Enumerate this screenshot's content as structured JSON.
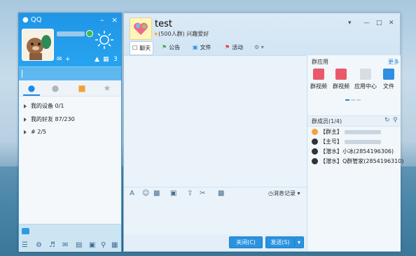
{
  "qq_panel": {
    "title": "QQ",
    "min_label": "–",
    "close_label": "×",
    "level_badge": "3",
    "groups": [
      {
        "label": "我的设备",
        "count": "0/1"
      },
      {
        "label": "我的好友",
        "count": "87/230"
      },
      {
        "label": "#",
        "count": "2/5"
      }
    ]
  },
  "chat": {
    "group_name": "test",
    "group_sub": "(500人群) 兴趣爱好",
    "toolbar": {
      "chat": "聊天",
      "notice": "公告",
      "files": "文件",
      "activity": "活动"
    },
    "message_record": "消息记录",
    "close_button": "关闭(C)",
    "send_button": "发送(S)"
  },
  "apps_panel": {
    "title": "群应用",
    "more": "更多",
    "apps": [
      {
        "label": "群视频",
        "color": "#e85a6b"
      },
      {
        "label": "群视频",
        "color": "#e85a6b"
      },
      {
        "label": "应用中心",
        "color": "#d6dde3"
      },
      {
        "label": "文件",
        "color": "#2f8fe0"
      }
    ]
  },
  "members": {
    "title": "群成员(1/4)",
    "list": [
      {
        "role": "【群主】",
        "name": ""
      },
      {
        "role": "【主号】",
        "name": ""
      },
      {
        "role": "【潜水】",
        "name": "小冰(2854196306)"
      },
      {
        "role": "【潜水】",
        "name": "Q群管家(2854196310)"
      }
    ]
  }
}
